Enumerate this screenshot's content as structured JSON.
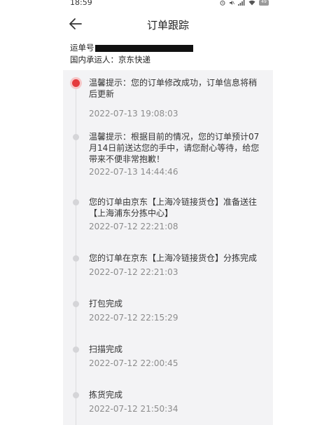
{
  "status_bar": {
    "time": "18:59",
    "icons": [
      "alarm-icon",
      "mute-icon",
      "signal-icon",
      "wifi-icon",
      "battery-icon"
    ],
    "battery_text": "49"
  },
  "header": {
    "title": "订单跟踪",
    "back_icon": "arrow-left-icon"
  },
  "shipment": {
    "waybill_label": "运单号",
    "carrier_label": "国内承运人：",
    "carrier_name": "京东快递"
  },
  "colors": {
    "accent": "#e4393c",
    "timeline_bg": "#f3f3f5",
    "time_text": "#8c8c8c"
  },
  "events": [
    {
      "text": "温馨提示：您的订单修改成功，订单信息将稍后更新",
      "time": "2022-07-13 19:08:03",
      "current": true
    },
    {
      "text": "温馨提示：根据目前的情况，您的订单预计07月14日前送达您的手中，请您耐心等待，给您带来不便非常抱歉！",
      "time": "2022-07-13 14:44:46",
      "current": false
    },
    {
      "text": "您的订单由京东【上海冷链接货仓】准备送往【上海浦东分拣中心】",
      "time": "2022-07-12 22:21:08",
      "current": false
    },
    {
      "text": "您的订单在京东【上海冷链接货仓】分拣完成",
      "time": "2022-07-12 22:21:03",
      "current": false
    },
    {
      "text": "打包完成",
      "time": "2022-07-12 22:15:29",
      "current": false
    },
    {
      "text": "扫描完成",
      "time": "2022-07-12 22:00:45",
      "current": false
    },
    {
      "text": "拣货完成",
      "time": "2022-07-12 21:50:34",
      "current": false
    }
  ]
}
